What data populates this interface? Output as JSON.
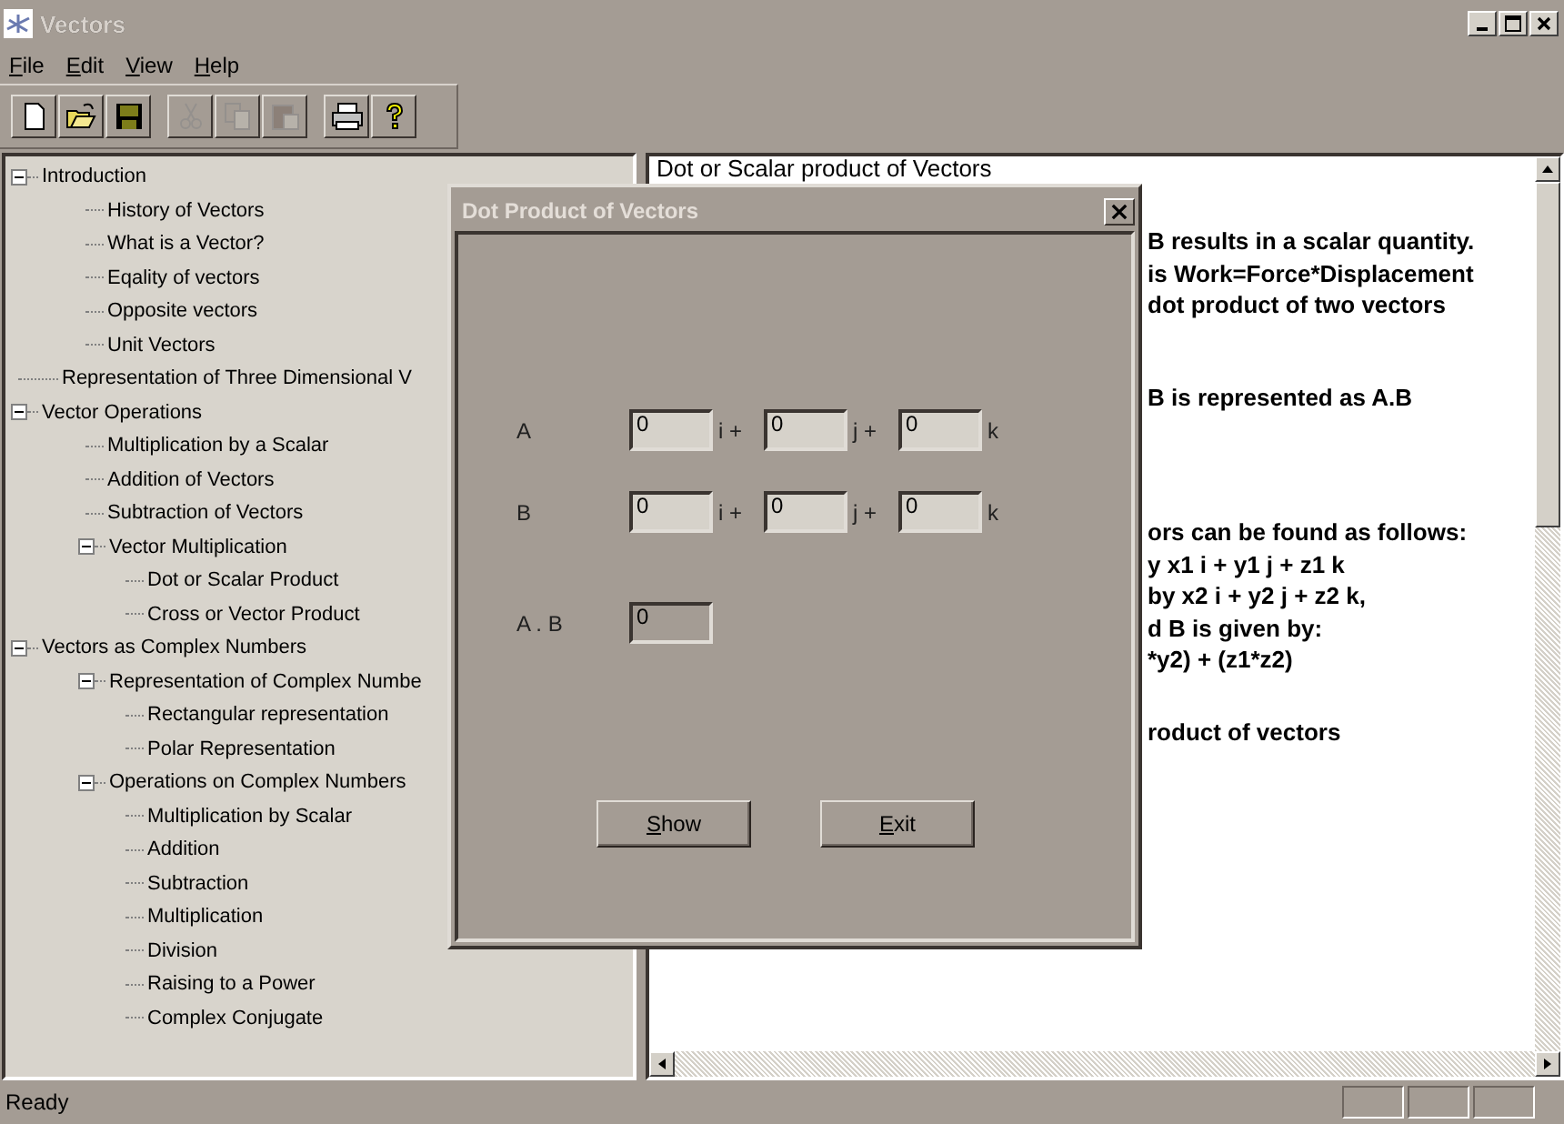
{
  "window": {
    "title": "Vectors"
  },
  "menu": [
    {
      "accel": "F",
      "rest": "ile"
    },
    {
      "accel": "E",
      "rest": "dit"
    },
    {
      "accel": "V",
      "rest": "iew"
    },
    {
      "accel": "H",
      "rest": "elp"
    }
  ],
  "toolbar": [
    {
      "kind": "new",
      "disabled": false
    },
    {
      "kind": "open",
      "disabled": false
    },
    {
      "kind": "save",
      "disabled": false
    },
    {
      "kind": "cut",
      "disabled": true
    },
    {
      "kind": "copy",
      "disabled": true
    },
    {
      "kind": "paste",
      "disabled": true
    },
    {
      "kind": "print",
      "disabled": false
    },
    {
      "kind": "help",
      "disabled": false
    }
  ],
  "tree": [
    {
      "label": "Introduction",
      "expanded": true,
      "children": [
        {
          "label": "History of Vectors"
        },
        {
          "label": "What is a Vector?"
        },
        {
          "label": "Eqality of vectors"
        },
        {
          "label": "Opposite vectors"
        },
        {
          "label": "Unit Vectors"
        }
      ]
    },
    {
      "label": "Representation of Three Dimensional V"
    },
    {
      "label": "Vector Operations",
      "expanded": true,
      "children": [
        {
          "label": "Multiplication by a Scalar"
        },
        {
          "label": "Addition of Vectors"
        },
        {
          "label": "Subtraction of Vectors"
        },
        {
          "label": "Vector Multiplication",
          "expanded": true,
          "children": [
            {
              "label": "Dot or Scalar Product"
            },
            {
              "label": "Cross or Vector Product"
            }
          ]
        }
      ]
    },
    {
      "label": "Vectors as Complex Numbers",
      "expanded": true,
      "children": [
        {
          "label": "Representation of Complex Numbe",
          "expanded": true,
          "children": [
            {
              "label": "Rectangular representation"
            },
            {
              "label": "Polar Representation"
            }
          ]
        },
        {
          "label": "Operations on Complex Numbers",
          "expanded": true,
          "children": [
            {
              "label": "Multiplication by Scalar"
            },
            {
              "label": "Addition"
            },
            {
              "label": "Subtraction"
            },
            {
              "label": "Multiplication"
            },
            {
              "label": "Division"
            },
            {
              "label": "Raising to a Power"
            },
            {
              "label": "Complex Conjugate"
            }
          ]
        }
      ]
    }
  ],
  "document": {
    "heading": "Dot or Scalar product of Vectors",
    "paragraphs": [
      [
        "B results in a scalar quantity.",
        "is Work=Force*Displacement",
        "dot product of two vectors"
      ],
      [
        "B is represented as A.B"
      ],
      [
        "ors can be found as follows:",
        "y  x1 i + y1 j + z1 k",
        "by x2 i + y2 j + z2 k,",
        "d B is given by:",
        "*y2)  + (z1*z2)"
      ],
      [
        "roduct of vectors"
      ]
    ]
  },
  "dialog": {
    "title": "Dot Product of Vectors",
    "rows": [
      {
        "label": "A",
        "components": [
          {
            "value": "0",
            "unit": "i +"
          },
          {
            "value": "0",
            "unit": "j +"
          },
          {
            "value": "0",
            "unit": "k"
          }
        ]
      },
      {
        "label": "B",
        "components": [
          {
            "value": "0",
            "unit": "i +"
          },
          {
            "value": "0",
            "unit": "j +"
          },
          {
            "value": "0",
            "unit": "k"
          }
        ]
      }
    ],
    "result": {
      "label": "A . B",
      "value": "0"
    },
    "buttons": [
      {
        "accel": "S",
        "rest": "how"
      },
      {
        "accel": "E",
        "rest": "xit"
      }
    ]
  },
  "status_bar": {
    "text": "Ready"
  }
}
